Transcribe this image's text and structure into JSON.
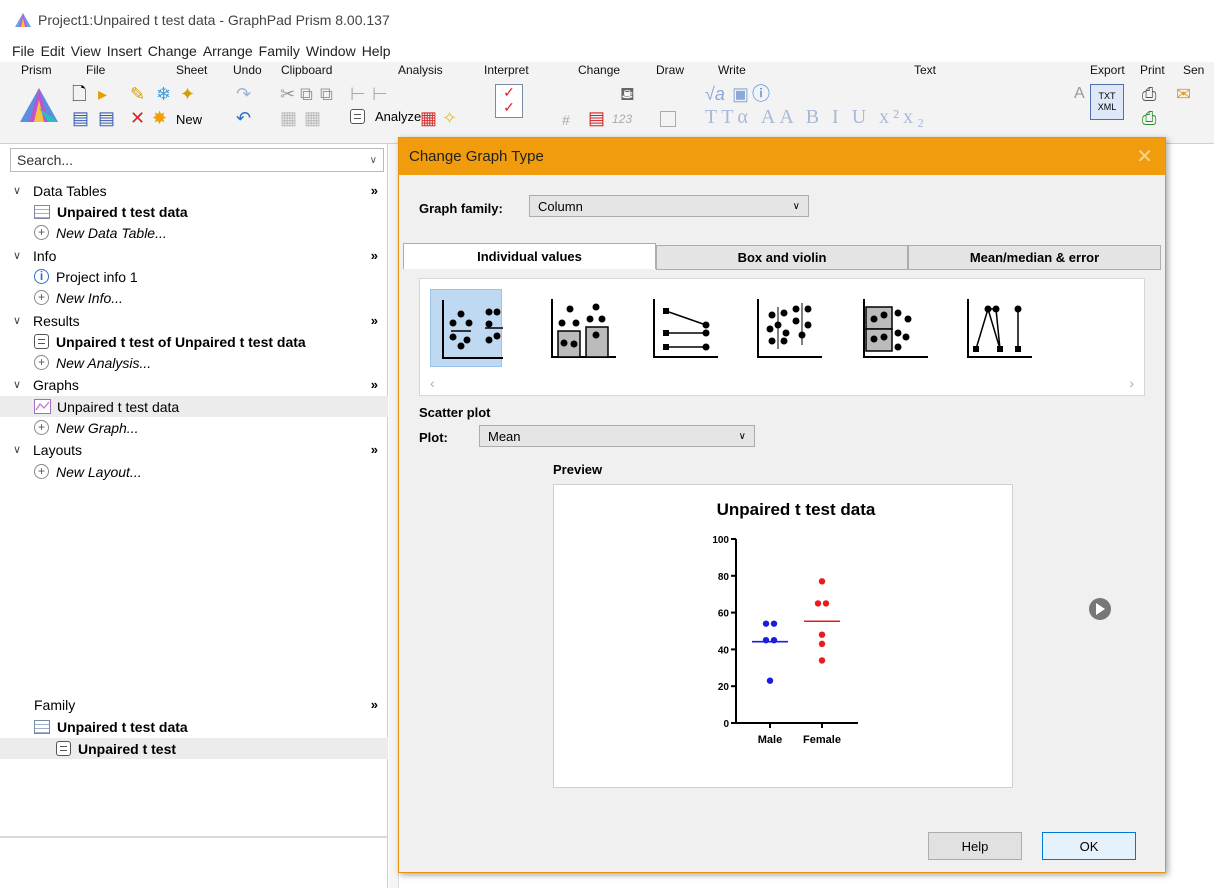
{
  "window": {
    "title": "Project1:Unpaired t test data - GraphPad Prism 8.00.137"
  },
  "menu": [
    "File",
    "Edit",
    "View",
    "Insert",
    "Change",
    "Arrange",
    "Family",
    "Window",
    "Help"
  ],
  "ribbon": {
    "groups": [
      "Prism",
      "File",
      "Sheet",
      "Undo",
      "Clipboard",
      "Analysis",
      "Interpret",
      "Change",
      "Draw",
      "Write",
      "Text",
      "Export",
      "Print",
      "Sen"
    ],
    "sheet_new_label": "New",
    "analyze_label": "Analyze",
    "export_icon_text": "TXT XML",
    "num_icon_text": "123"
  },
  "navigator": {
    "search_placeholder": "Search...",
    "more_glyph": "»",
    "sections": [
      {
        "label": "Data Tables",
        "items": [
          {
            "label": "Unpaired t test data",
            "bold": true
          },
          {
            "label": "New Data Table...",
            "italic": true
          }
        ]
      },
      {
        "label": "Info",
        "items": [
          {
            "label": "Project info 1"
          },
          {
            "label": "New Info...",
            "italic": true
          }
        ]
      },
      {
        "label": "Results",
        "items": [
          {
            "label": "Unpaired t test of Unpaired t test data",
            "bold": true
          },
          {
            "label": "New Analysis...",
            "italic": true
          }
        ]
      },
      {
        "label": "Graphs",
        "items": [
          {
            "label": "Unpaired t test data",
            "selected": true
          },
          {
            "label": "New Graph...",
            "italic": true
          }
        ]
      },
      {
        "label": "Layouts",
        "items": [
          {
            "label": "New Layout...",
            "italic": true
          }
        ]
      }
    ]
  },
  "family": {
    "label": "Family",
    "items": [
      {
        "label": "Unpaired t test data"
      },
      {
        "label": "Unpaired t test",
        "selected": true
      }
    ]
  },
  "dialog": {
    "title": "Change Graph Type",
    "graph_family_label": "Graph family:",
    "graph_family_value": "Column",
    "tabs": [
      "Individual values",
      "Box and violin",
      "Mean/median & error"
    ],
    "active_tab": 0,
    "selected_thumbnail": 0,
    "scatter_label": "Scatter plot",
    "plot_label": "Plot:",
    "plot_value": "Mean",
    "preview_label": "Preview",
    "help_button": "Help",
    "ok_button": "OK",
    "colors": {
      "titlebar": "#f09c0c",
      "male": "#1c1ce0",
      "female": "#e81c1c"
    }
  },
  "chart_data": {
    "type": "scatter",
    "title": "Unpaired t test data",
    "xlabel": "",
    "ylabel": "",
    "categories": [
      "Male",
      "Female"
    ],
    "ylim": [
      0,
      100
    ],
    "yticks": [
      0,
      20,
      40,
      60,
      80,
      100
    ],
    "series": [
      {
        "name": "Male",
        "values": [
          54,
          54,
          45,
          45,
          23
        ],
        "mean": 44.2
      },
      {
        "name": "Female",
        "values": [
          77,
          65,
          65,
          48,
          43,
          34
        ],
        "mean": 55.3
      }
    ]
  }
}
